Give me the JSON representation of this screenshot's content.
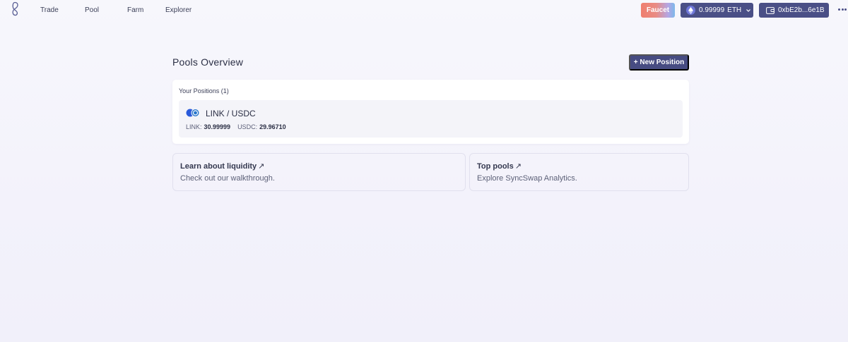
{
  "nav": {
    "items": [
      {
        "label": "Trade"
      },
      {
        "label": "Pool"
      },
      {
        "label": "Farm"
      },
      {
        "label": "Explorer"
      }
    ]
  },
  "header": {
    "faucet_label": "Faucet",
    "balance_value": "0.99999",
    "balance_unit": "ETH",
    "wallet_address": "0xbE2b...6e1B"
  },
  "pools": {
    "title": "Pools Overview",
    "new_position_label": "+ New Position",
    "positions_heading": "Your Positions (1)",
    "positions": [
      {
        "pair": "LINK / USDC",
        "token_a_label": "LINK:",
        "token_a_amount": "30.99999",
        "token_b_label": "USDC:",
        "token_b_amount": "29.96710"
      }
    ]
  },
  "cards": [
    {
      "title": "Learn about liquidity",
      "arrow": "↗",
      "description": "Check out our walkthrough."
    },
    {
      "title": "Top pools",
      "arrow": "↗",
      "description": "Explore SyncSwap Analytics."
    }
  ],
  "colors": {
    "primary": "#4a4f86",
    "background": "#f5f4fb"
  },
  "icons": {
    "logo": "syncswap-logo-icon",
    "eth": "ethereum-icon",
    "wallet": "wallet-icon",
    "more": "more-dots-icon",
    "pair": "token-pair-icon"
  }
}
